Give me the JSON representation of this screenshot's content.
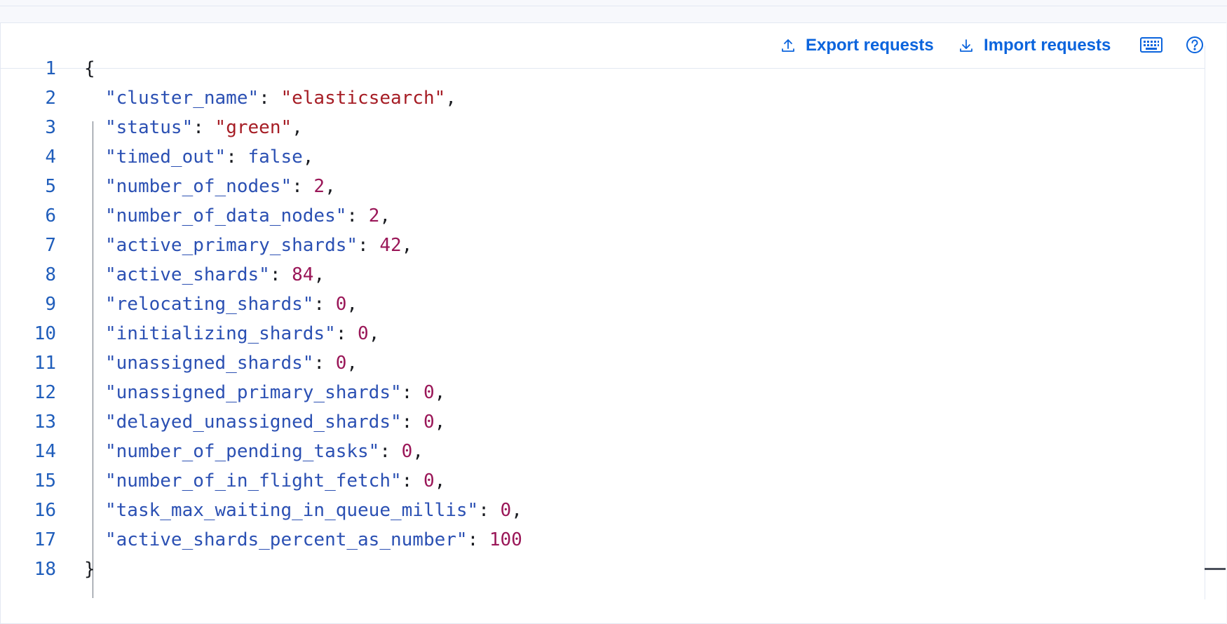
{
  "toolbar": {
    "export_label": "Export requests",
    "import_label": "Import requests",
    "export_icon": "upload-icon",
    "import_icon": "download-icon",
    "keyboard_icon": "keyboard-icon",
    "help_icon": "help-icon"
  },
  "colors": {
    "accent": "#0b64dd",
    "key": "#2b50b3",
    "string": "#a61d25",
    "number": "#9a1758",
    "line_number": "#1f5dbb"
  },
  "editor": {
    "lines": [
      {
        "num": "1",
        "open": "{"
      },
      {
        "num": "2",
        "key": "\"cluster_name\"",
        "value": "\"elasticsearch\"",
        "type": "string",
        "trail": ","
      },
      {
        "num": "3",
        "key": "\"status\"",
        "value": "\"green\"",
        "type": "string",
        "trail": ","
      },
      {
        "num": "4",
        "key": "\"timed_out\"",
        "value": "false",
        "type": "bool",
        "trail": ","
      },
      {
        "num": "5",
        "key": "\"number_of_nodes\"",
        "value": "2",
        "type": "number",
        "trail": ","
      },
      {
        "num": "6",
        "key": "\"number_of_data_nodes\"",
        "value": "2",
        "type": "number",
        "trail": ","
      },
      {
        "num": "7",
        "key": "\"active_primary_shards\"",
        "value": "42",
        "type": "number",
        "trail": ","
      },
      {
        "num": "8",
        "key": "\"active_shards\"",
        "value": "84",
        "type": "number",
        "trail": ","
      },
      {
        "num": "9",
        "key": "\"relocating_shards\"",
        "value": "0",
        "type": "number",
        "trail": ","
      },
      {
        "num": "10",
        "key": "\"initializing_shards\"",
        "value": "0",
        "type": "number",
        "trail": ","
      },
      {
        "num": "11",
        "key": "\"unassigned_shards\"",
        "value": "0",
        "type": "number",
        "trail": ","
      },
      {
        "num": "12",
        "key": "\"unassigned_primary_shards\"",
        "value": "0",
        "type": "number",
        "trail": ","
      },
      {
        "num": "13",
        "key": "\"delayed_unassigned_shards\"",
        "value": "0",
        "type": "number",
        "trail": ","
      },
      {
        "num": "14",
        "key": "\"number_of_pending_tasks\"",
        "value": "0",
        "type": "number",
        "trail": ","
      },
      {
        "num": "15",
        "key": "\"number_of_in_flight_fetch\"",
        "value": "0",
        "type": "number",
        "trail": ","
      },
      {
        "num": "16",
        "key": "\"task_max_waiting_in_queue_millis\"",
        "value": "0",
        "type": "number",
        "trail": ","
      },
      {
        "num": "17",
        "key": "\"active_shards_percent_as_number\"",
        "value": "100",
        "type": "number",
        "trail": ""
      },
      {
        "num": "18",
        "open": "}"
      }
    ]
  }
}
